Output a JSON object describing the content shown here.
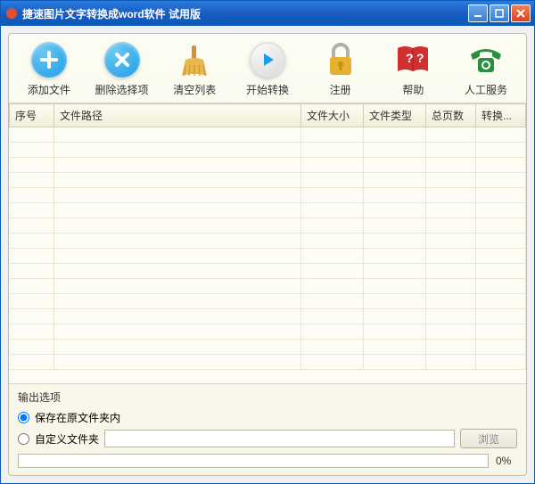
{
  "titlebar": {
    "title": "捷速图片文字转换成word软件 试用版"
  },
  "toolbar": {
    "add": "添加文件",
    "delete": "删除选择项",
    "clear": "清空列表",
    "start": "开始转换",
    "register": "注册",
    "help": "帮助",
    "service": "人工服务"
  },
  "table": {
    "headers": {
      "seq": "序号",
      "path": "文件路径",
      "size": "文件大小",
      "type": "文件类型",
      "pages": "总页数",
      "convert": "转换..."
    }
  },
  "output": {
    "title": "输出选项",
    "save_original": "保存在原文件夹内",
    "custom_folder": "自定义文件夹",
    "browse": "浏览",
    "custom_path": "",
    "progress_pct": "0%"
  }
}
